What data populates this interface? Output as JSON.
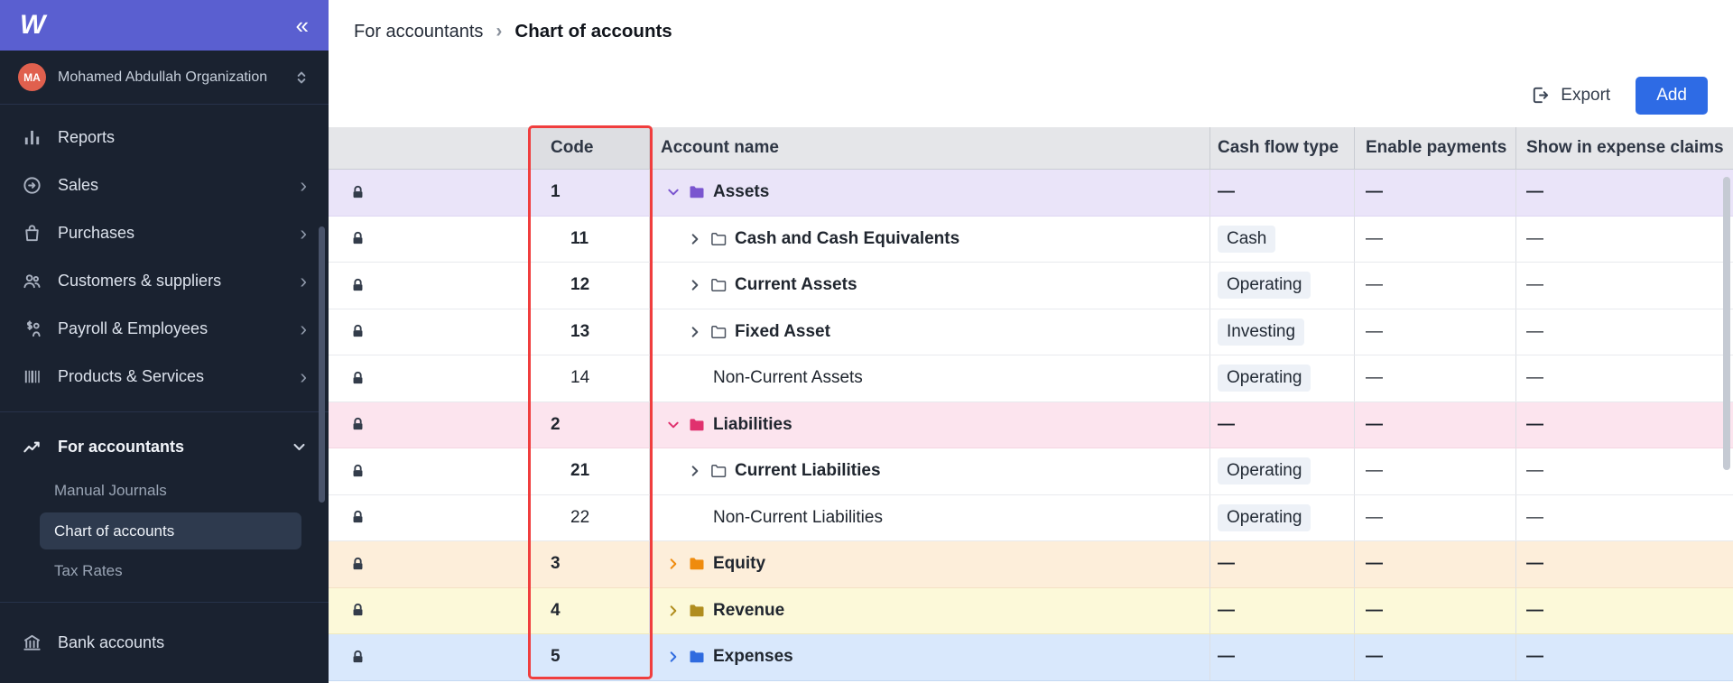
{
  "colors": {
    "sidebar_bg": "#1a2230",
    "brand_purple": "#5a5fd0",
    "avatar_orange": "#e0604e",
    "add_button_blue": "#2e6be5",
    "code_highlight_red": "#f03e3e",
    "row_assets_bg": "#eae4f9",
    "row_liabilities_bg": "#fce4ee",
    "row_equity_bg": "#fdeeda",
    "row_revenue_bg": "#fcf9d9",
    "row_expenses_bg": "#d9e8fc",
    "assets_accent": "#7a55cf",
    "liabilities_accent": "#e0316e",
    "equity_accent": "#ef8b0e",
    "revenue_accent": "#b08d1e",
    "expenses_accent": "#2f6bdf"
  },
  "sidebar": {
    "logo_text": "W",
    "collapse_glyph": "«",
    "org": {
      "avatar": "MA",
      "name": "Mohamed Abdullah Organization"
    },
    "items": [
      {
        "label": "Reports"
      },
      {
        "label": "Sales"
      },
      {
        "label": "Purchases"
      },
      {
        "label": "Customers & suppliers"
      },
      {
        "label": "Payroll & Employees"
      },
      {
        "label": "Products & Services"
      },
      {
        "label": "For accountants"
      },
      {
        "label": "Bank accounts"
      }
    ],
    "accountants_children": [
      {
        "label": "Manual Journals"
      },
      {
        "label": "Chart of accounts"
      },
      {
        "label": "Tax Rates"
      }
    ]
  },
  "breadcrumb": {
    "parent": "For accountants",
    "separator": "›",
    "current": "Chart of accounts"
  },
  "toolbar": {
    "export_label": "Export",
    "add_label": "Add"
  },
  "table": {
    "headers": {
      "code": "Code",
      "account_name": "Account name",
      "cash_flow_type": "Cash flow type",
      "enable_payments": "Enable payments",
      "show_in_expense_claims": "Show in expense claims"
    },
    "rows": [
      {
        "code": "1",
        "name": "Assets",
        "cash_flow": "—",
        "enable_payments": "—",
        "show_in_expense_claims": "—"
      },
      {
        "code": "11",
        "name": "Cash and Cash Equivalents",
        "cash_flow": "Cash",
        "enable_payments": "—",
        "show_in_expense_claims": "—"
      },
      {
        "code": "12",
        "name": "Current Assets",
        "cash_flow": "Operating",
        "enable_payments": "—",
        "show_in_expense_claims": "—"
      },
      {
        "code": "13",
        "name": "Fixed Asset",
        "cash_flow": "Investing",
        "enable_payments": "—",
        "show_in_expense_claims": "—"
      },
      {
        "code": "14",
        "name": "Non-Current Assets",
        "cash_flow": "Operating",
        "enable_payments": "—",
        "show_in_expense_claims": "—"
      },
      {
        "code": "2",
        "name": "Liabilities",
        "cash_flow": "—",
        "enable_payments": "—",
        "show_in_expense_claims": "—"
      },
      {
        "code": "21",
        "name": "Current Liabilities",
        "cash_flow": "Operating",
        "enable_payments": "—",
        "show_in_expense_claims": "—"
      },
      {
        "code": "22",
        "name": "Non-Current Liabilities",
        "cash_flow": "Operating",
        "enable_payments": "—",
        "show_in_expense_claims": "—"
      },
      {
        "code": "3",
        "name": "Equity",
        "cash_flow": "—",
        "enable_payments": "—",
        "show_in_expense_claims": "—"
      },
      {
        "code": "4",
        "name": "Revenue",
        "cash_flow": "—",
        "enable_payments": "—",
        "show_in_expense_claims": "—"
      },
      {
        "code": "5",
        "name": "Expenses",
        "cash_flow": "—",
        "enable_payments": "—",
        "show_in_expense_claims": "—"
      }
    ]
  }
}
